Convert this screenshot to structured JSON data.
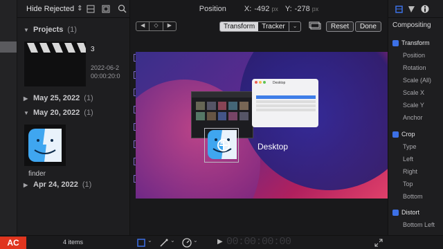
{
  "browser": {
    "filter_label": "Hide Rejected",
    "projects_title": "Projects",
    "projects_count": "(1)",
    "project_name": "3",
    "project_date": "2022-06-2",
    "project_duration": "00:00:20:0",
    "events": [
      {
        "label": "May 25, 2022",
        "count": "(1)"
      },
      {
        "label": "May 20, 2022",
        "count": "(1)"
      },
      {
        "label": "Apr 24, 2022",
        "count": "(1)"
      }
    ],
    "clip_name": "finder",
    "items_count": "4 items",
    "badge": "AC"
  },
  "viewer": {
    "position_label": "Position",
    "x_label": "X:",
    "x_value": "-492",
    "x_unit": "px",
    "y_label": "Y:",
    "y_value": "-278",
    "y_unit": "px",
    "mode_transform": "Transform",
    "mode_tracker": "Tracker",
    "reset_label": "Reset",
    "done_label": "Done",
    "overlay_text": "Desktop",
    "desktop_window_title": "Desktop",
    "timecode": "00:00:00:00"
  },
  "inspector": {
    "compositing": "Compositing",
    "transform": "Transform",
    "transform_rows": [
      "Position",
      "Rotation",
      "Scale (All)",
      "Scale X",
      "Scale Y",
      "Anchor"
    ],
    "crop": "Crop",
    "crop_rows": [
      "Type",
      "Left",
      "Right",
      "Top",
      "Bottom"
    ],
    "distort": "Distort",
    "distort_rows": [
      "Bottom Left"
    ]
  },
  "colors": {
    "accent": "#3c70e6",
    "badge": "#e0351e"
  }
}
